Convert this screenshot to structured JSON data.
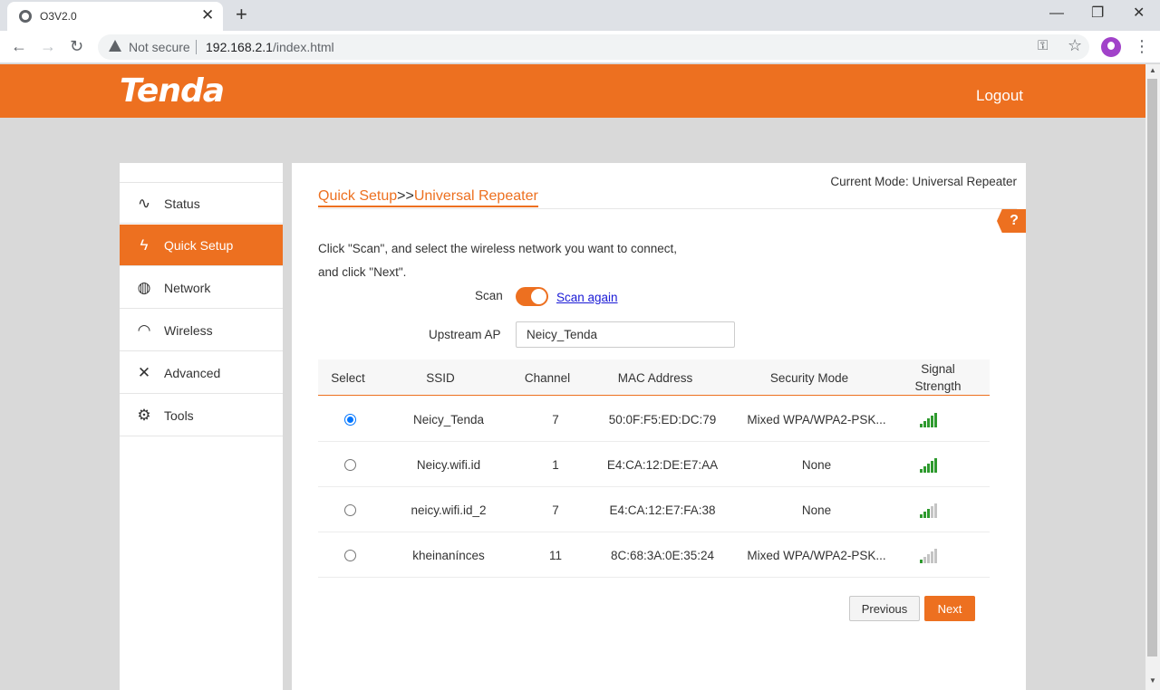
{
  "browser": {
    "tab_title": "O3V2.0",
    "tab_close": "✕",
    "new_tab": "+",
    "minimize": "—",
    "restore": "❐",
    "close": "✕",
    "security_text": "Not secure",
    "url_host": "192.168.2.1",
    "url_path": "/index.html",
    "icons": [
      "favicon-globe-icon",
      "back-icon",
      "forward-icon",
      "reload-icon",
      "warning-icon",
      "key-icon",
      "star-icon",
      "profile-icon",
      "menu-icon"
    ]
  },
  "header": {
    "logo": "Tenda",
    "logout": "Logout",
    "accent_color": "#ed7020"
  },
  "sidebar": {
    "items": [
      {
        "label": "Status",
        "icon": "activity-icon",
        "glyph": "∿",
        "active": false
      },
      {
        "label": "Quick Setup",
        "icon": "lightning-icon",
        "glyph": "ϟ",
        "active": true
      },
      {
        "label": "Network",
        "icon": "globe-icon",
        "glyph": "◍",
        "active": false
      },
      {
        "label": "Wireless",
        "icon": "wifi-icon",
        "glyph": "◠",
        "active": false
      },
      {
        "label": "Advanced",
        "icon": "tools-icon",
        "glyph": "✕",
        "active": false
      },
      {
        "label": "Tools",
        "icon": "gear-icon",
        "glyph": "⚙",
        "active": false
      }
    ]
  },
  "main": {
    "current_mode": "Current Mode: Universal Repeater",
    "breadcrumb": {
      "parent": "Quick Setup",
      "separator": ">>",
      "current": "Universal Repeater"
    },
    "help": "?",
    "instruction_line1": "Click \"Scan\", and select the wireless network you want to connect,",
    "instruction_line2": "and click \"Next\".",
    "scan_label": "Scan",
    "scan_toggle_on": true,
    "scan_again": "Scan again",
    "upstream_label": "Upstream AP",
    "upstream_value": "Neicy_Tenda",
    "table": {
      "headers": {
        "select": "Select",
        "ssid": "SSID",
        "channel": "Channel",
        "mac": "MAC Address",
        "security": "Security Mode",
        "signal_line1": "Signal",
        "signal_line2": "Strength"
      },
      "rows": [
        {
          "selected": true,
          "ssid": "Neicy_Tenda",
          "channel": "7",
          "mac": "50:0F:F5:ED:DC:79",
          "security": "Mixed WPA/WPA2-PSK...",
          "signal_bars": 5
        },
        {
          "selected": false,
          "ssid": "Neicy.wifi.id",
          "channel": "1",
          "mac": "E4:CA:12:DE:E7:AA",
          "security": "None",
          "signal_bars": 5
        },
        {
          "selected": false,
          "ssid": "neicy.wifi.id_2",
          "channel": "7",
          "mac": "E4:CA:12:E7:FA:38",
          "security": "None",
          "signal_bars": 3
        },
        {
          "selected": false,
          "ssid": "kheinanínces",
          "channel": "11",
          "mac": "8C:68:3A:0E:35:24",
          "security": "Mixed WPA/WPA2-PSK...",
          "signal_bars": 1
        }
      ]
    },
    "previous_label": "Previous",
    "next_label": "Next"
  }
}
